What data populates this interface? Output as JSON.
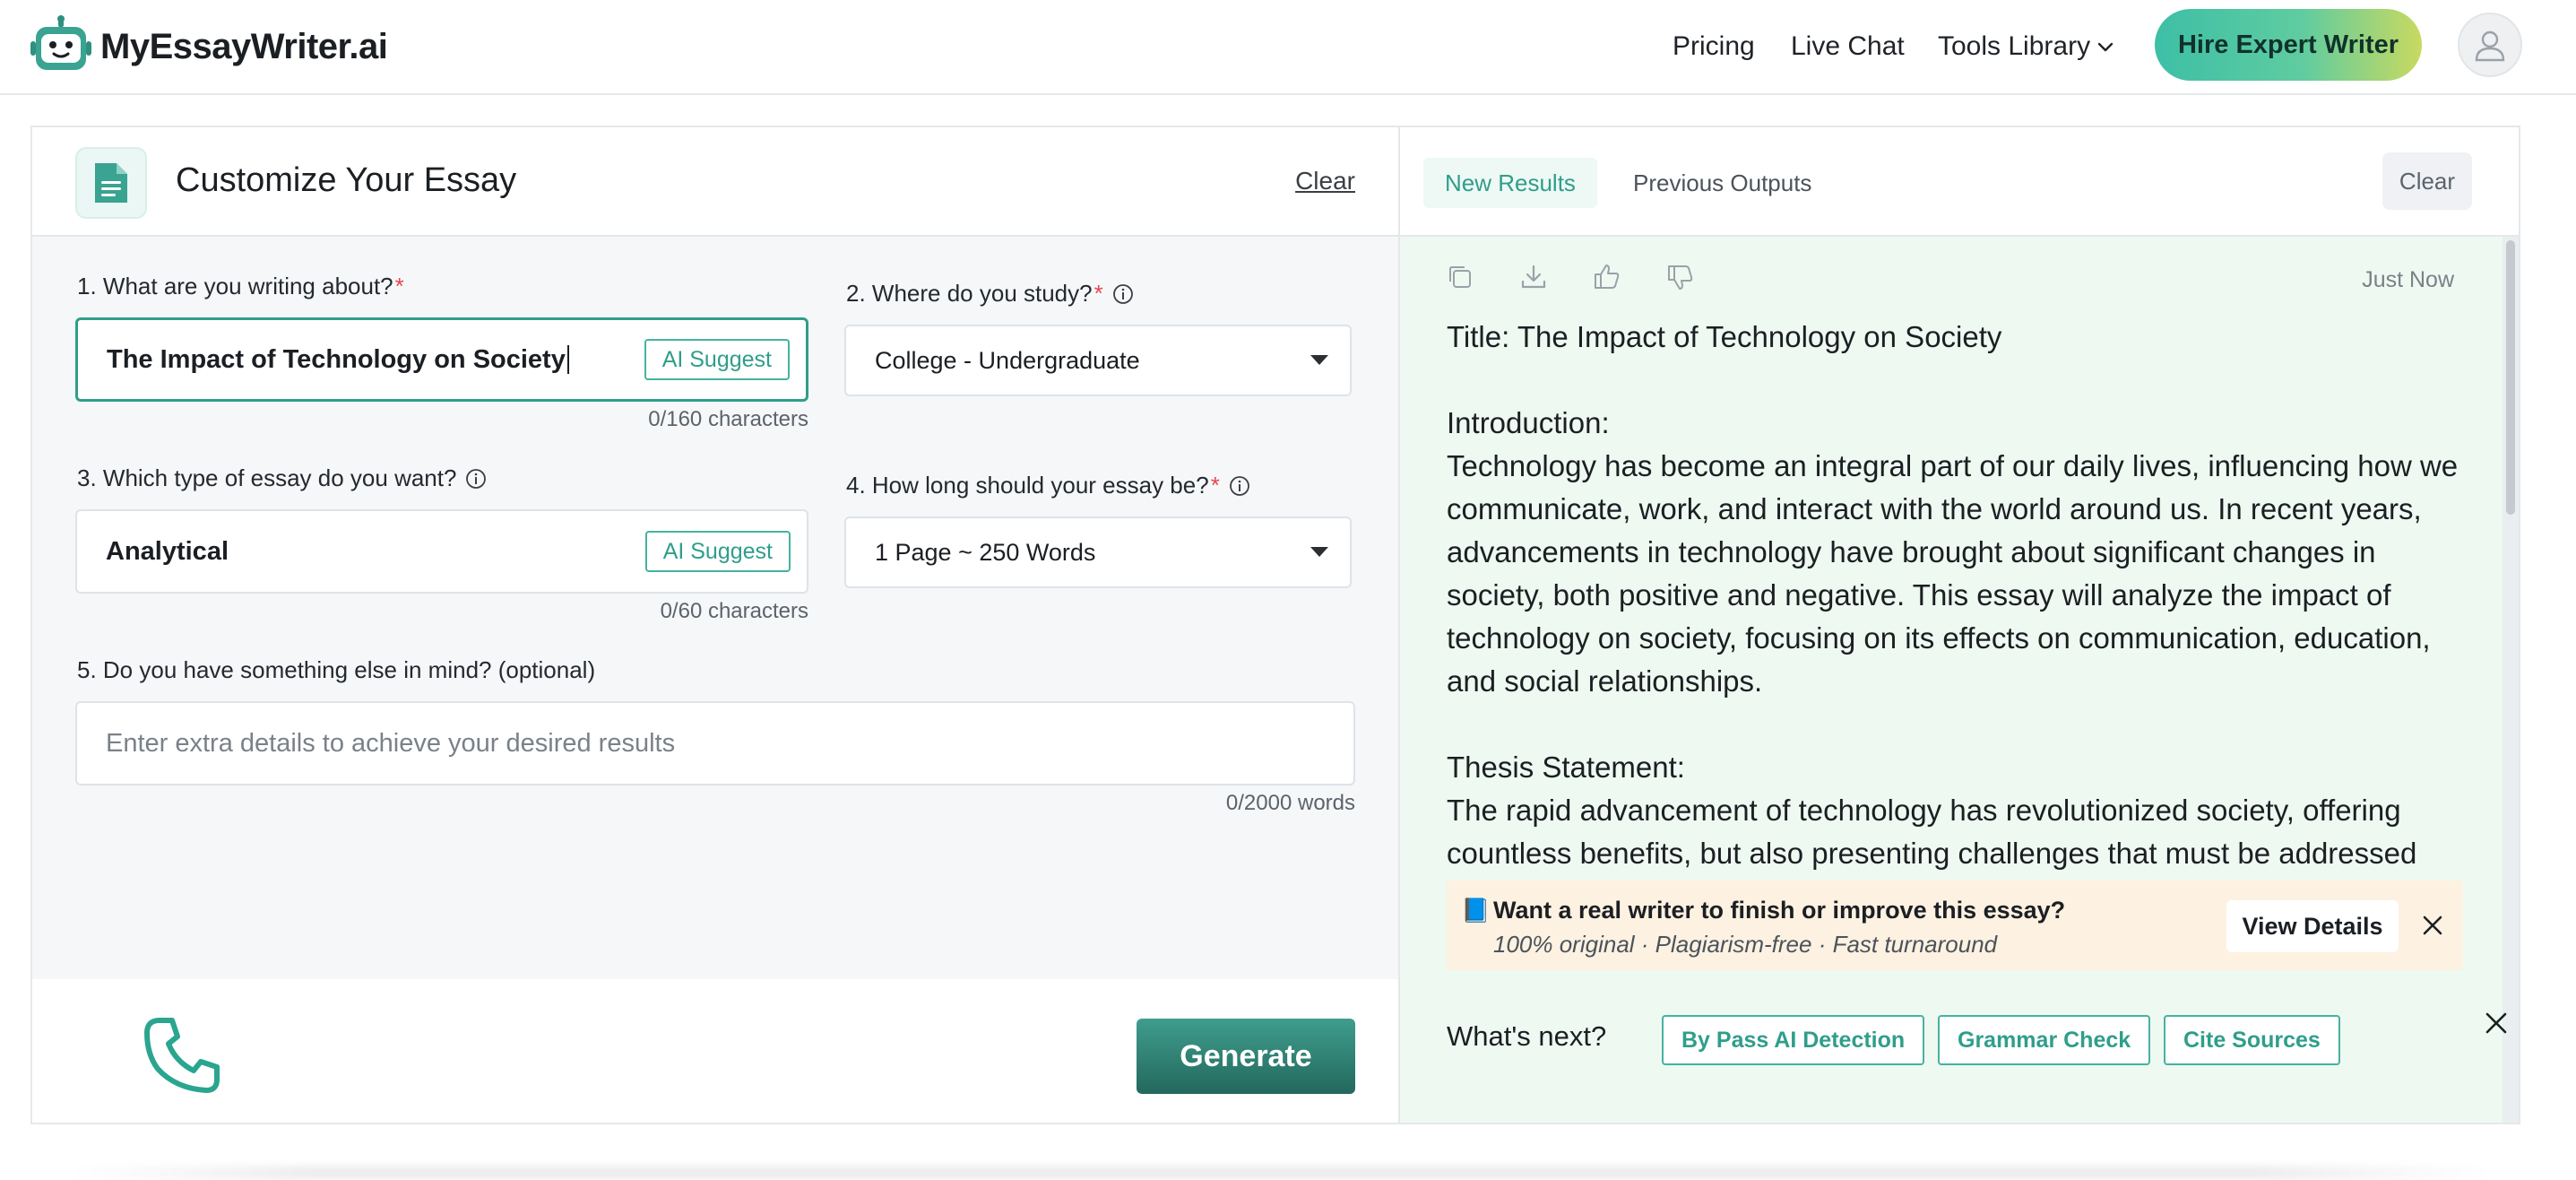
{
  "brand": {
    "name": "MyEssayWriter.ai"
  },
  "nav": {
    "pricing": "Pricing",
    "live_chat": "Live Chat",
    "tools_library": "Tools Library",
    "hire_button": "Hire Expert Writer"
  },
  "left_panel": {
    "title": "Customize Your Essay",
    "clear": "Clear",
    "q1": {
      "label": "1. What are you writing about?",
      "value": "The Impact of Technology on Society",
      "ai_button": "AI Suggest",
      "counter": "0/160 characters"
    },
    "q2": {
      "label": "2. Where do you study?",
      "selected": "College - Undergraduate"
    },
    "q3": {
      "label": "3. Which type of essay do you want?",
      "value": "Analytical",
      "ai_button": "AI Suggest",
      "counter": "0/60 characters"
    },
    "q4": {
      "label": "4. How long should your essay be?",
      "selected": "1 Page ~ 250 Words"
    },
    "q5": {
      "label": "5. Do you have something else in mind? (optional)",
      "placeholder": "Enter extra details to achieve your desired results",
      "counter": "0/2000 words"
    },
    "required_mark": "*",
    "generate": "Generate"
  },
  "right_panel": {
    "tabs": {
      "new_results": "New Results",
      "previous_outputs": "Previous Outputs"
    },
    "clear": "Clear",
    "timestamp": "Just Now",
    "essay": {
      "title_line": "Title: The Impact of Technology on Society",
      "intro_heading": "Introduction:",
      "intro_body": "Technology has become an integral part of our daily lives, influencing how we communicate, work, and interact with the world around us. In recent years, advancements in technology have brought about significant changes in society, both positive and negative. This essay will analyze the impact of technology on society, focusing on its effects on communication, education, and social relationships.",
      "thesis_heading": "Thesis Statement:",
      "thesis_body": "The rapid advancement of technology has revolutionized society, offering countless benefits, but also presenting challenges that must be addressed"
    },
    "promo": {
      "icon": "📘",
      "title": "Want a real writer to finish or improve this essay?",
      "subtitle": "100% original · Plagiarism-free · Fast turnaround",
      "button": "View Details"
    },
    "whats_next": {
      "label": "What's next?",
      "options": [
        "By Pass AI Detection",
        "Grammar Check",
        "Cite Sources"
      ]
    }
  },
  "colors": {
    "accent": "#2f9e8b",
    "result_bg": "#eef9f1",
    "promo_bg": "#fdf1e1",
    "required": "#e5484d"
  }
}
